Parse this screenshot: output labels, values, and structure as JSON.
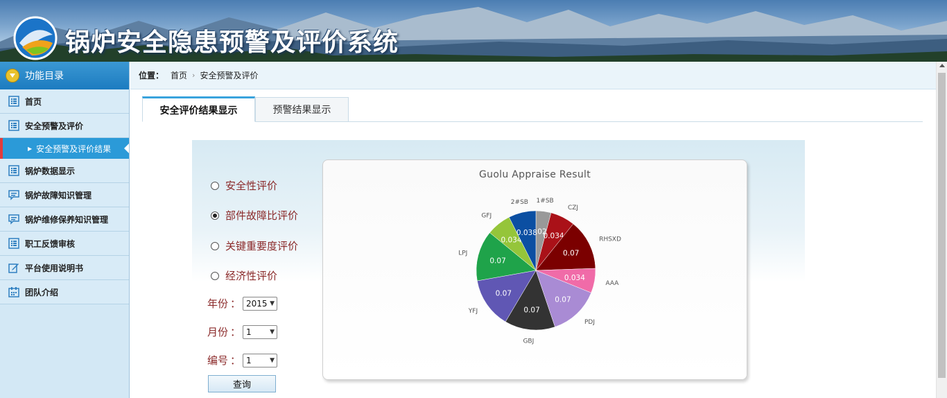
{
  "app": {
    "title": "锅炉安全隐患预警及评价系统"
  },
  "sidebar": {
    "header": "功能目录",
    "items": [
      {
        "label": "首页",
        "icon": "list-icon"
      },
      {
        "label": "安全预警及评价",
        "icon": "list-icon"
      },
      {
        "label": "安全预警及评价结果",
        "icon": "arrow-icon",
        "submenu": true,
        "active": true
      },
      {
        "label": "锅炉数据显示",
        "icon": "list-icon"
      },
      {
        "label": "锅炉故障知识管理",
        "icon": "chat-icon"
      },
      {
        "label": "锅炉维修保养知识管理",
        "icon": "chat-icon"
      },
      {
        "label": "职工反馈审核",
        "icon": "list-icon"
      },
      {
        "label": "平台使用说明书",
        "icon": "edit-icon"
      },
      {
        "label": "团队介绍",
        "icon": "calendar-icon"
      }
    ]
  },
  "breadcrumb": {
    "label": "位置：",
    "items": [
      "首页",
      "安全预警及评价"
    ]
  },
  "tabs": [
    {
      "label": "安全评价结果显示",
      "active": true
    },
    {
      "label": "预警结果显示",
      "active": false
    }
  ],
  "form": {
    "radios": [
      {
        "label": "安全性评价",
        "checked": false
      },
      {
        "label": "部件故障比评价",
        "checked": true
      },
      {
        "label": "关键重要度评价",
        "checked": false
      },
      {
        "label": "经济性评价",
        "checked": false
      }
    ],
    "year": {
      "label": "年份",
      "colon": "：",
      "value": "2015"
    },
    "month": {
      "label": "月份",
      "colon": "：",
      "value": "1"
    },
    "number": {
      "label": "编号",
      "colon": "：",
      "value": "1"
    },
    "query_label": "查询"
  },
  "chart_data": {
    "type": "pie",
    "title": "Guolu Appraise Result",
    "slices": [
      {
        "name": "1#SB",
        "value": 0.021,
        "label": "0.021",
        "color": "#999999"
      },
      {
        "name": "CZJ",
        "value": 0.034,
        "label": "0.034",
        "color": "#aa1118"
      },
      {
        "name": "RHSXD",
        "value": 0.07,
        "label": "0.07",
        "color": "#7b0000"
      },
      {
        "name": "AAA",
        "value": 0.034,
        "label": "0.034",
        "color": "#f06ba8"
      },
      {
        "name": "PDJ",
        "value": 0.07,
        "label": "0.07",
        "color": "#a98bd4"
      },
      {
        "name": "GBJ",
        "value": 0.07,
        "label": "0.07",
        "color": "#333333"
      },
      {
        "name": "YFJ",
        "value": 0.07,
        "label": "0.07",
        "color": "#6057b4"
      },
      {
        "name": "LPJ",
        "value": 0.07,
        "label": "0.07",
        "color": "#1fa34a"
      },
      {
        "name": "GFJ",
        "value": 0.034,
        "label": "0.034",
        "color": "#95c53a"
      },
      {
        "name": "2#SB",
        "value": 0.038,
        "label": "0.038",
        "color": "#0b4fa2"
      }
    ]
  }
}
